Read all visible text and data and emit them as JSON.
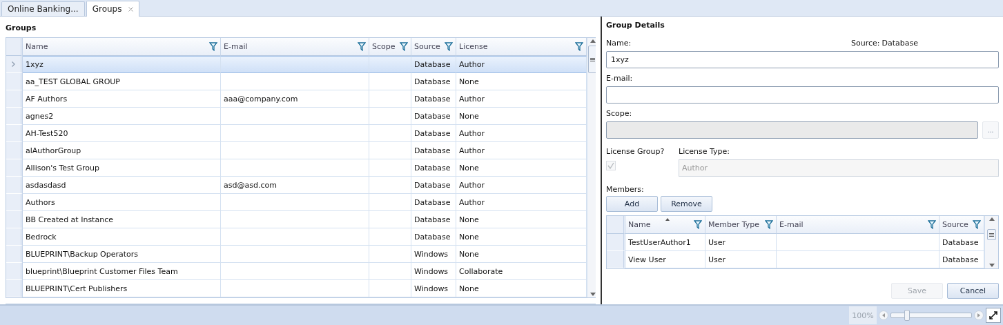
{
  "tabs": [
    {
      "label": "Online Banking...",
      "selected": false,
      "closable": false
    },
    {
      "label": "Groups",
      "selected": true,
      "closable": true
    }
  ],
  "groups": {
    "title": "Groups",
    "columns": [
      {
        "label": "Name"
      },
      {
        "label": "E-mail"
      },
      {
        "label": "Scope"
      },
      {
        "label": "Source"
      },
      {
        "label": "License"
      }
    ],
    "rows": [
      {
        "cells": [
          "1xyz",
          "",
          "",
          "Database",
          "Author"
        ],
        "selected": true
      },
      {
        "cells": [
          "aa_TEST GLOBAL GROUP",
          "",
          "",
          "Database",
          "None"
        ],
        "selected": false
      },
      {
        "cells": [
          "AF Authors",
          "aaa@company.com",
          "",
          "Database",
          "Author"
        ],
        "selected": false
      },
      {
        "cells": [
          "agnes2",
          "",
          "",
          "Database",
          "None"
        ],
        "selected": false
      },
      {
        "cells": [
          "AH-Test520",
          "",
          "",
          "Database",
          "Author"
        ],
        "selected": false
      },
      {
        "cells": [
          "alAuthorGroup",
          "",
          "",
          "Database",
          "Author"
        ],
        "selected": false
      },
      {
        "cells": [
          "Allison's Test Group",
          "",
          "",
          "Database",
          "None"
        ],
        "selected": false
      },
      {
        "cells": [
          "asdasdasd",
          "asd@asd.com",
          "",
          "Database",
          "Author"
        ],
        "selected": false
      },
      {
        "cells": [
          "Authors",
          "",
          "",
          "Database",
          "Author"
        ],
        "selected": false
      },
      {
        "cells": [
          "BB Created at Instance",
          "",
          "",
          "Database",
          "None"
        ],
        "selected": false
      },
      {
        "cells": [
          "Bedrock",
          "",
          "",
          "Database",
          "None"
        ],
        "selected": false
      },
      {
        "cells": [
          "BLUEPRINT\\Backup Operators",
          "",
          "",
          "Windows",
          "None"
        ],
        "selected": false
      },
      {
        "cells": [
          "blueprint\\Blueprint Customer Files Team",
          "",
          "",
          "Windows",
          "Collaborate"
        ],
        "selected": false
      },
      {
        "cells": [
          "BLUEPRINT\\Cert Publishers",
          "",
          "",
          "Windows",
          "None"
        ],
        "selected": false
      }
    ]
  },
  "details": {
    "title": "Group Details",
    "name_label": "Name:",
    "source_label": "Source:",
    "source_value": "Database",
    "name_value": "1xyz",
    "email_label": "E-mail:",
    "scope_label": "Scope:",
    "scope_disabled": true,
    "scope_button": "...",
    "license_group_label": "License Group?",
    "license_group_checked": true,
    "license_group_disabled": true,
    "license_type_label": "License Type:",
    "license_type_value": "Author",
    "members_label": "Members:",
    "add_button": "Add",
    "remove_button": "Remove",
    "members": {
      "columns": [
        {
          "label": "Name",
          "sorted": true
        },
        {
          "label": "Member Type",
          "sorted": false
        },
        {
          "label": "E-mail",
          "sorted": false
        },
        {
          "label": "Source",
          "sorted": false
        }
      ],
      "rows": [
        {
          "cells": [
            "TestUserAuthor1",
            "User",
            "",
            "Database"
          ],
          "selected": false
        },
        {
          "cells": [
            "View User",
            "User",
            "",
            "Database"
          ],
          "selected": false
        }
      ]
    },
    "save_button": {
      "label": "Save",
      "disabled": true
    },
    "cancel_button": {
      "label": "Cancel",
      "disabled": false
    }
  },
  "status_bar": {
    "zoom_text": "100%",
    "zoom": {
      "level": 0.2
    }
  }
}
